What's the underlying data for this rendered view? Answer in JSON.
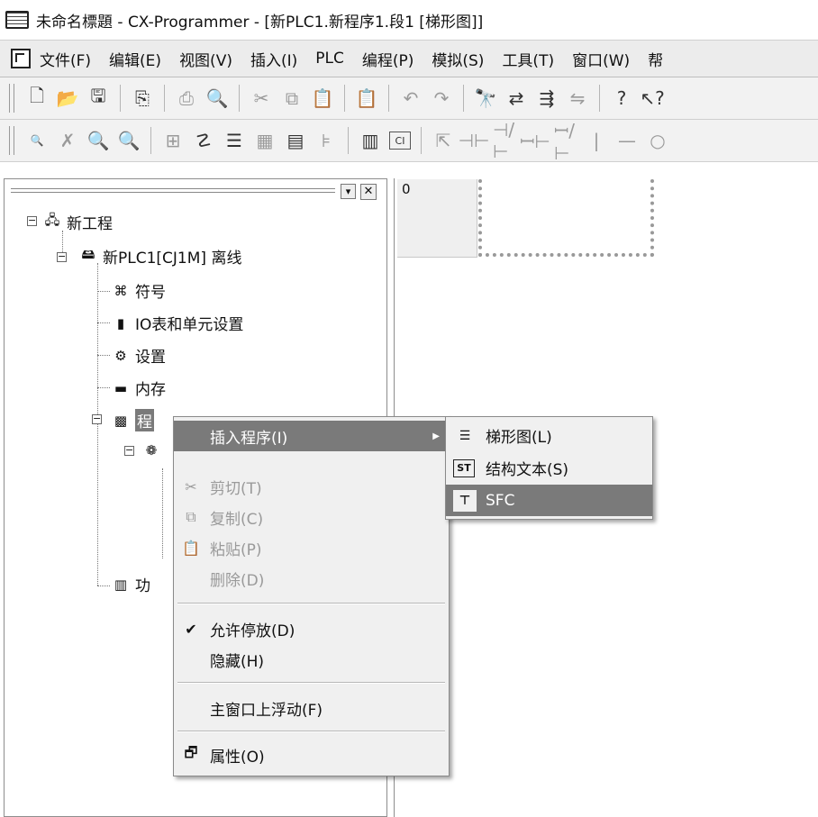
{
  "window": {
    "title": "未命名標題 - CX-Programmer - [新PLC1.新程序1.段1 [梯形图]]"
  },
  "menubar": {
    "items": [
      "文件(F)",
      "编辑(E)",
      "视图(V)",
      "插入(I)",
      "PLC",
      "编程(P)",
      "模拟(S)",
      "工具(T)",
      "窗口(W)",
      "帮"
    ]
  },
  "toolbar1": {
    "icons": [
      "new-file-icon",
      "open-folder-icon",
      "save-icon",
      "print-setup-icon",
      "print-icon",
      "print-preview-icon",
      "cut-icon",
      "copy-icon",
      "paste-icon",
      "paste-special-icon",
      "undo-icon",
      "redo-icon",
      "find-icon",
      "replace-icon",
      "cross-reference-icon",
      "compare-icon",
      "help-icon",
      "context-help-icon"
    ]
  },
  "toolbar2": {
    "icons": [
      "zoom-small-icon",
      "zoom-fit-icon",
      "zoom-in-icon",
      "zoom-out-icon",
      "grid-icon",
      "comment-icon",
      "list-icon",
      "rung-icon",
      "monitor-icon",
      "tree-icon",
      "smart-input-icon",
      "ci-icon",
      "select-icon",
      "contact-no-icon",
      "contact-nc-icon",
      "contact-or-icon",
      "contact-or-nc-icon",
      "vertical-line-icon",
      "horizontal-line-icon",
      "coil-icon"
    ]
  },
  "tree": {
    "project": "新工程",
    "plc": "新PLC1[CJ1M] 离线",
    "symbols": "符号",
    "io_table": "IO表和单元设置",
    "settings": "设置",
    "memory": "内存",
    "programs": "程",
    "function_blocks": "功"
  },
  "editor": {
    "rung_number": "0"
  },
  "context_menu": {
    "insert_program": "插入程序(I)",
    "cut": "剪切(T)",
    "copy": "复制(C)",
    "paste": "粘贴(P)",
    "delete": "删除(D)",
    "allow_docking": "允许停放(D)",
    "hide": "隐藏(H)",
    "float_main_window": "主窗口上浮动(F)",
    "properties": "属性(O)"
  },
  "submenu": {
    "ladder": "梯形图(L)",
    "structured_text": "结构文本(S)",
    "sfc": "SFC"
  }
}
